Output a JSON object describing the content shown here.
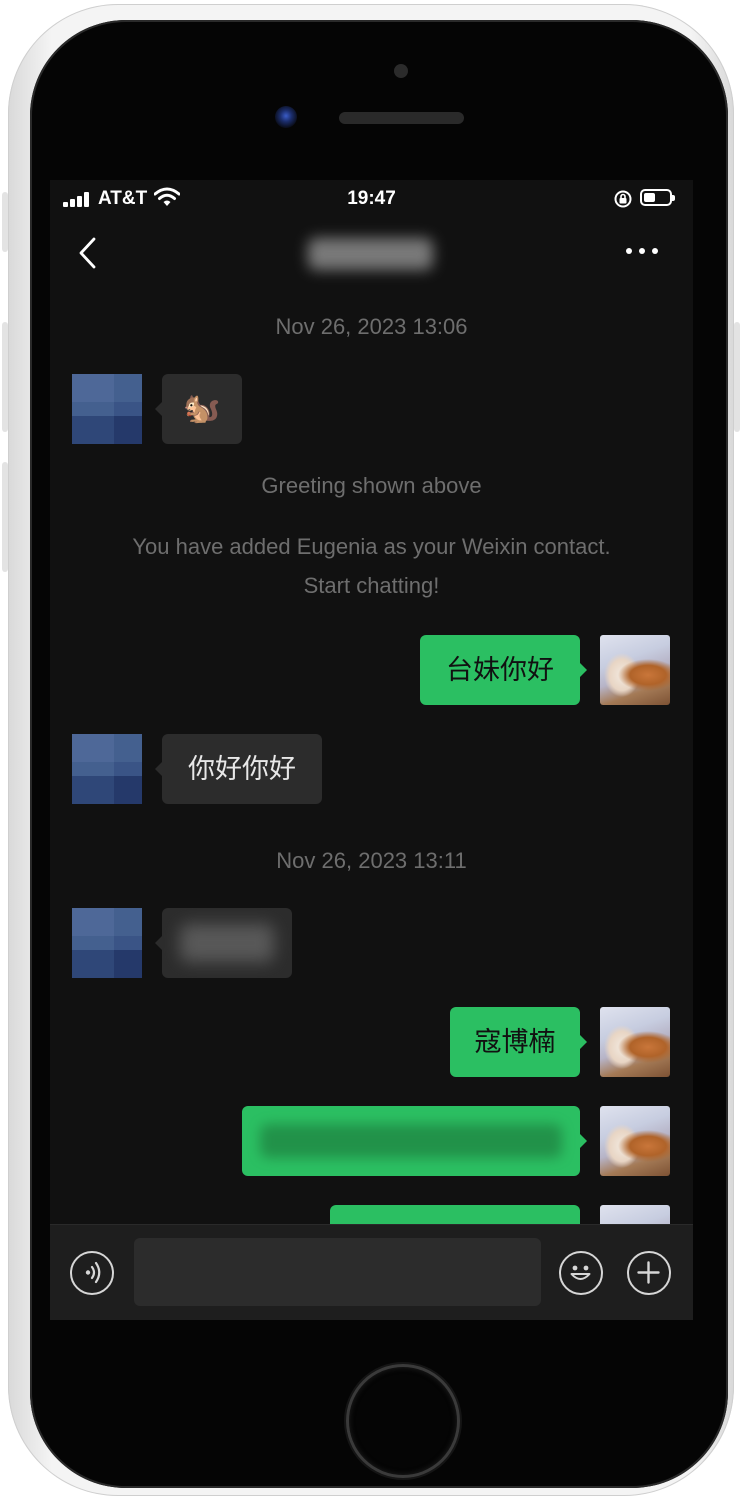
{
  "status_bar": {
    "carrier": "AT&T",
    "time": "19:47",
    "battery_level": 0.45,
    "icons": [
      "signal-icon",
      "wifi-icon",
      "orientation-lock-icon",
      "battery-icon"
    ]
  },
  "nav": {
    "back_icon": "chevron-left-icon",
    "more_icon": "more-dots-icon"
  },
  "chat": {
    "timestamps": [
      "Nov 26, 2023 13:06",
      "Nov 26, 2023 13:11"
    ],
    "messages": [
      {
        "direction": "in",
        "text": "🐿️"
      },
      {
        "direction": "out",
        "text": "台妹你好"
      },
      {
        "direction": "in",
        "text": "你好你好"
      },
      {
        "direction": "in",
        "text": ""
      },
      {
        "direction": "out",
        "text": "寇博楠"
      },
      {
        "direction": "out",
        "text": ""
      },
      {
        "direction": "out",
        "text": ""
      }
    ],
    "system_notes": {
      "greeting": "Greeting shown above",
      "added_line1": "You have added Eugenia as your Weixin contact.",
      "added_line2": "Start chatting!"
    }
  },
  "input_bar": {
    "voice_icon": "voice-icon",
    "emoji_icon": "emoji-icon",
    "plus_icon": "plus-icon",
    "input_value": ""
  },
  "colors": {
    "background": "#111111",
    "incoming_bubble": "#2c2c2c",
    "outgoing_bubble": "#2bbf62",
    "meta_text": "#6e6e6e"
  }
}
